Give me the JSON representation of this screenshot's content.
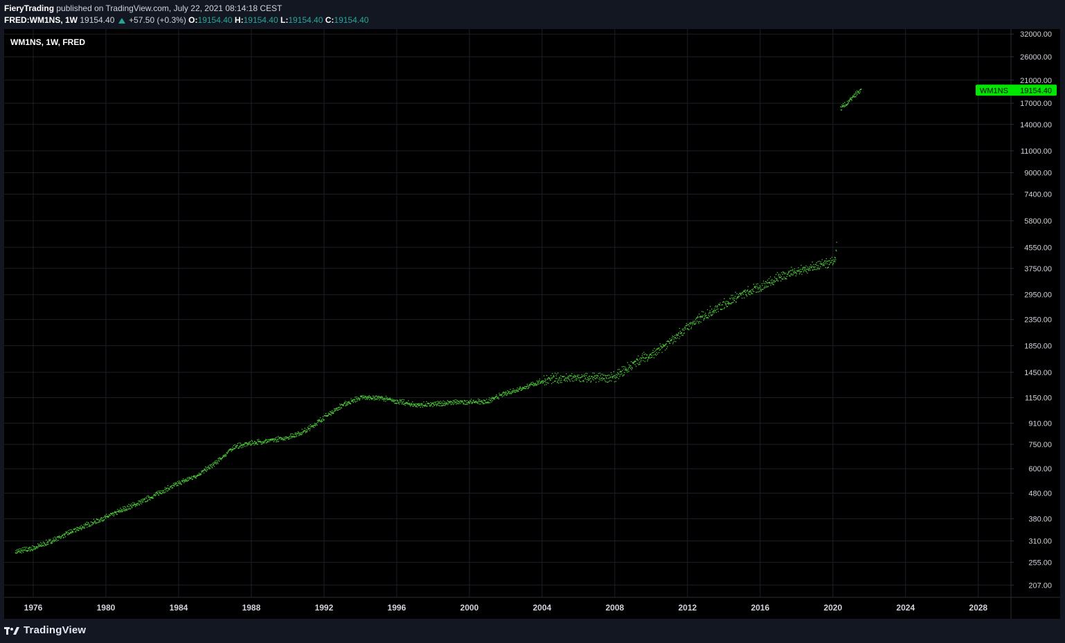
{
  "header": {
    "publisher": "FieryTrading",
    "published_text": "published on TradingView.com, July 22, 2021 08:14:18 CEST",
    "symbol": "FRED:WM1NS, 1W",
    "last": "19154.40",
    "change": "+57.50 (+0.3%)",
    "o_label": "O:",
    "o_value": "19154.40",
    "h_label": "H:",
    "h_value": "19154.40",
    "l_label": "L:",
    "l_value": "19154.40",
    "c_label": "C:",
    "c_value": "19154.40"
  },
  "legend": {
    "title": "WM1NS, 1W, FRED"
  },
  "price_tag": {
    "label": "WM1NS",
    "value": "19154.40"
  },
  "footer": {
    "brand": "TradingView"
  },
  "colors": {
    "series": "#4cd137",
    "tag": "#00e600",
    "background": "#000000",
    "panel": "#131722",
    "grid": "#1e222d",
    "teal": "#26a69a"
  },
  "chart_data": {
    "type": "scatter",
    "title": "WM1NS, 1W, FRED",
    "y_scale": "log",
    "grid": true,
    "xlim": [
      1974.4,
      2029.8
    ],
    "ylim": [
      185,
      33500
    ],
    "x_ticks": [
      "1976",
      "1980",
      "1984",
      "1988",
      "1992",
      "1996",
      "2000",
      "2004",
      "2008",
      "2012",
      "2016",
      "2020",
      "2024",
      "2028"
    ],
    "y_ticks": [
      "32000.00",
      "26000.00",
      "21000.00",
      "17000.00",
      "14000.00",
      "11000.00",
      "9000.00",
      "7400.00",
      "5800.00",
      "4550.00",
      "3750.00",
      "2950.00",
      "2350.00",
      "1850.00",
      "1450.00",
      "1150.00",
      "910.00",
      "750.00",
      "600.00",
      "480.00",
      "380.00",
      "310.00",
      "255.00",
      "207.00"
    ],
    "series": [
      {
        "name": "WM1NS",
        "points": [
          [
            1975.0,
            280
          ],
          [
            1976.0,
            290
          ],
          [
            1977.0,
            310
          ],
          [
            1978.0,
            335
          ],
          [
            1979.0,
            360
          ],
          [
            1980.0,
            385
          ],
          [
            1981.0,
            415
          ],
          [
            1982.0,
            445
          ],
          [
            1983.0,
            485
          ],
          [
            1984.0,
            525
          ],
          [
            1985.0,
            565
          ],
          [
            1986.0,
            630
          ],
          [
            1987.0,
            730
          ],
          [
            1988.0,
            760
          ],
          [
            1989.0,
            775
          ],
          [
            1990.0,
            800
          ],
          [
            1991.0,
            850
          ],
          [
            1992.0,
            960
          ],
          [
            1993.0,
            1075
          ],
          [
            1994.0,
            1150
          ],
          [
            1995.0,
            1150
          ],
          [
            1996.0,
            1110
          ],
          [
            1997.0,
            1075
          ],
          [
            1998.0,
            1080
          ],
          [
            1999.0,
            1100
          ],
          [
            2000.0,
            1105
          ],
          [
            2001.0,
            1110
          ],
          [
            2002.0,
            1200
          ],
          [
            2003.0,
            1260
          ],
          [
            2004.0,
            1340
          ],
          [
            2005.0,
            1370
          ],
          [
            2006.0,
            1370
          ],
          [
            2007.0,
            1370
          ],
          [
            2008.0,
            1380
          ],
          [
            2008.8,
            1520
          ],
          [
            2009.5,
            1650
          ],
          [
            2010.0,
            1690
          ],
          [
            2011.0,
            1900
          ],
          [
            2012.0,
            2200
          ],
          [
            2013.0,
            2450
          ],
          [
            2014.0,
            2700
          ],
          [
            2015.0,
            2950
          ],
          [
            2016.0,
            3150
          ],
          [
            2017.0,
            3450
          ],
          [
            2018.0,
            3650
          ],
          [
            2019.0,
            3800
          ],
          [
            2020.0,
            3950
          ],
          [
            2020.15,
            4200
          ],
          [
            2020.2,
            5000
          ],
          [
            2020.4,
            16200
          ],
          [
            2020.7,
            16800
          ],
          [
            2021.0,
            17700
          ],
          [
            2021.3,
            18600
          ],
          [
            2021.55,
            19154.4
          ]
        ]
      }
    ],
    "last_value": 19154.4
  }
}
